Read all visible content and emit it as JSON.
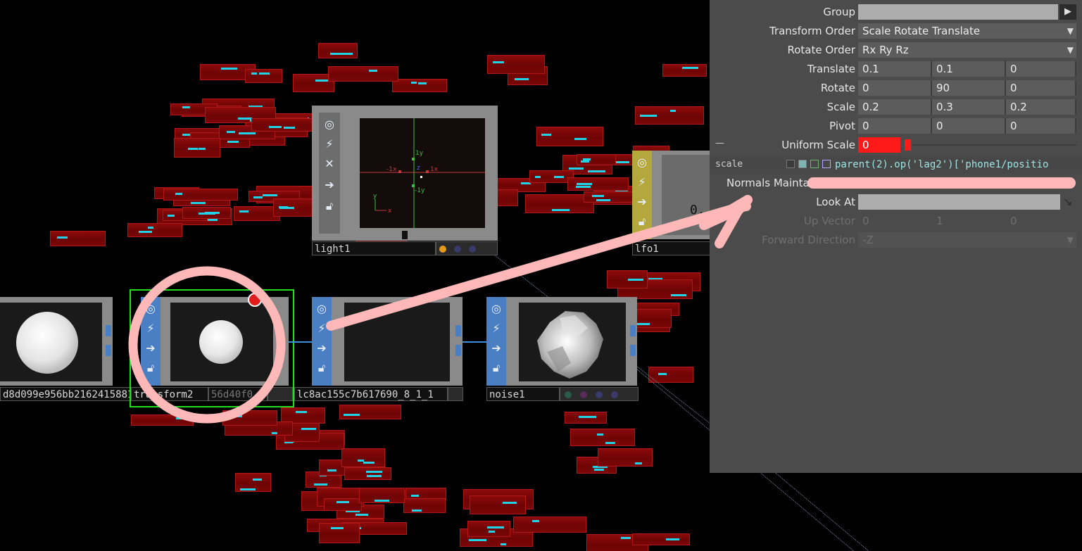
{
  "nodes": {
    "node_left_label": "d8d099e956bb2162415881",
    "transform": {
      "label": "transform2",
      "overlap_text": "56d40f0"
    },
    "middle": {
      "label": "lc8ac155c7b617690_8_1_1",
      "overlap_text": "ac155c7"
    },
    "light": {
      "label": "light1",
      "axis_labels": [
        "1y",
        "-1x",
        "1x",
        "z",
        "-1y",
        "y",
        "x"
      ]
    },
    "lfo": {
      "label": "lfo1",
      "value": "0."
    },
    "noise": {
      "label": "noise1"
    }
  },
  "panel": {
    "group": {
      "label": "Group"
    },
    "transform_order": {
      "label": "Transform Order",
      "value": "Scale Rotate Translate"
    },
    "rotate_order": {
      "label": "Rotate Order",
      "value": "Rx Ry Rz"
    },
    "translate": {
      "label": "Translate",
      "values": [
        "0.1",
        "0.1",
        "0"
      ]
    },
    "rotate": {
      "label": "Rotate",
      "values": [
        "0",
        "90",
        "0"
      ]
    },
    "scale": {
      "label": "Scale",
      "values": [
        "0.2",
        "0.3",
        "0.2"
      ]
    },
    "pivot": {
      "label": "Pivot",
      "values": [
        "0",
        "0",
        "0"
      ]
    },
    "collapse_marker": "—",
    "uniform_scale": {
      "label": "Uniform Scale",
      "value": "0"
    },
    "scale_expr": {
      "name": "scale",
      "expression": "parent(2).op('lag2')['phone1/positio"
    },
    "normals": {
      "label": "Normals Maintain"
    },
    "look_at": {
      "label": "Look At"
    },
    "up_vector": {
      "label": "Up Vector",
      "values": [
        "0",
        "1",
        "0"
      ]
    },
    "forward_direction": {
      "label": "Forward Direction",
      "value": "-Z"
    }
  },
  "colors": {
    "panel_bg": "#4b4b4b",
    "highlight_red": "#ff1a1a",
    "annotation_pink": "#ffb8b8",
    "node_blue": "#4a7fc4",
    "selection_green": "#22dd22"
  }
}
